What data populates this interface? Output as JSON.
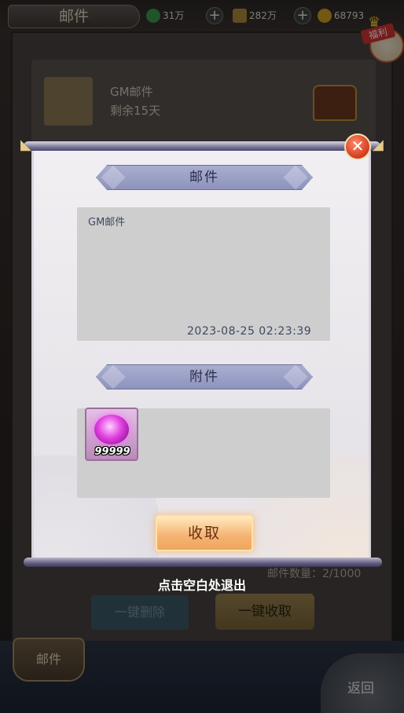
{
  "background": {
    "tab_title": "邮件",
    "resources": [
      {
        "name": "energy",
        "value": "31万",
        "color": "#3c9a4a"
      },
      {
        "name": "silver",
        "value": "282万",
        "color": "#b08a3a"
      },
      {
        "name": "gold",
        "value": "68793",
        "color": "#d4a020"
      }
    ],
    "welfare_label": "福利",
    "mail_item": {
      "title": "GM邮件",
      "subtitle": "剩余15天"
    },
    "mail_count": "邮件数量：2/1000",
    "delete_all_label": "一键删除",
    "claim_all_label": "一键收取",
    "bottom_tab_label": "邮件",
    "back_label": "返回"
  },
  "modal": {
    "mail_header": "邮件",
    "mail_body": "GM邮件",
    "mail_time": "2023-08-25  02:23:39",
    "attachment_header": "附件",
    "attachments": [
      {
        "icon": "pink-gem-icon",
        "count": "99999"
      }
    ],
    "claim_label": "收取",
    "close_icon": "close-icon",
    "exit_hint": "点击空白处退出"
  },
  "colors": {
    "header_fill": "#a9aed0",
    "claim_button": "#f5b271",
    "close_button": "#d23a1e"
  }
}
